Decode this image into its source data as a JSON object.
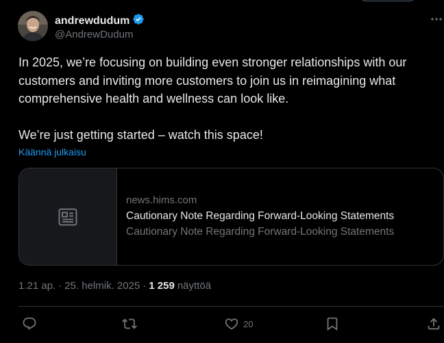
{
  "author": {
    "name": "andrewdudum",
    "handle": "@AndrewDudum",
    "verified": true,
    "verified_color": "#1d9bf0"
  },
  "tweet": {
    "text": "In 2025, we’re focusing on building even stronger relationships with our customers and inviting more customers to join us in reimagining what comprehensive health and wellness can look like.\n\nWe’re just getting started – watch this space!",
    "translate_label": "Käännä julkaisu"
  },
  "link_card": {
    "domain": "news.hims.com",
    "title": "Cautionary Note Regarding Forward-Looking Statements",
    "description": "Cautionary Note Regarding Forward-Looking Statements",
    "thumbnail_icon": "article-icon"
  },
  "meta": {
    "time": "1.21 ap.",
    "separator": "·",
    "date": "25. helmik. 2025",
    "views_count": "1 259",
    "views_label": "näyttöä"
  },
  "actions": {
    "reply_icon": "reply-icon",
    "retweet_icon": "retweet-icon",
    "like_icon": "heart-icon",
    "like_count": "20",
    "bookmark_icon": "bookmark-icon",
    "share_icon": "share-icon"
  },
  "colors": {
    "background": "#000000",
    "text_primary": "#e7e9ea",
    "text_secondary": "#71767b",
    "accent": "#1d9bf0",
    "border": "#2f3336"
  }
}
